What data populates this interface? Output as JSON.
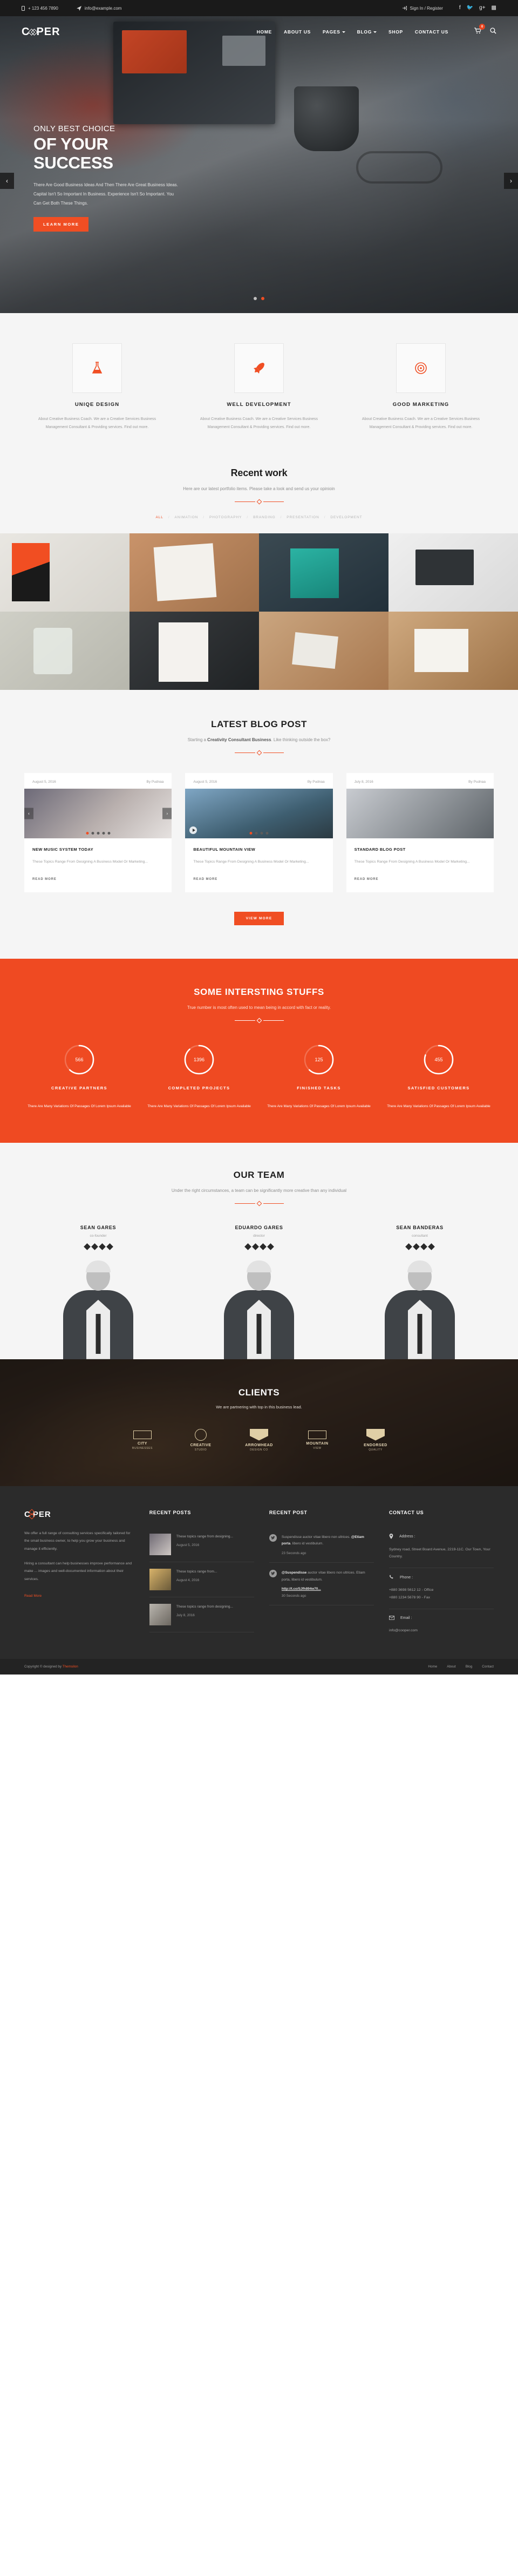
{
  "topbar": {
    "phone": "+ 123 456 7890",
    "email": "info@example.com",
    "signin": "Sign In / Register",
    "socials": [
      "facebook-icon",
      "twitter-icon",
      "google-plus-icon",
      "flickr-icon"
    ]
  },
  "nav": {
    "logo": "COOPER",
    "logo_left": "C",
    "logo_right": "PER",
    "items": [
      {
        "label": "HOME",
        "caret": false
      },
      {
        "label": "ABOUT US",
        "caret": false
      },
      {
        "label": "PAGES",
        "caret": true
      },
      {
        "label": "BLOG",
        "caret": true
      },
      {
        "label": "SHOP",
        "caret": false
      },
      {
        "label": "CONTACT US",
        "caret": false
      }
    ],
    "cart_count": "0"
  },
  "hero": {
    "sup": "ONLY BEST CHOICE",
    "line1": "OF YOUR",
    "line2": "SUCCESS",
    "paragraph": "There Are Good Business Ideas And Then There Are Great Business Ideas. Capital Isn't So Important In Business. Experience Isn't So Important. You Can Get Both These Things.",
    "cta": "LEARN MORE",
    "prev": "‹",
    "next": "›"
  },
  "services": [
    {
      "icon": "flask-icon",
      "title": "UNIQE DESIGN",
      "text": "About Creative Business Coach. We are a Creative Services Business Management Consultant & Providing services. Find out more."
    },
    {
      "icon": "rocket-icon",
      "title": "WELL DEVELOPMENT",
      "text": "About Creative Business Coach. We are a Creative Services Business Management Consultant & Providing services. Find out more."
    },
    {
      "icon": "target-icon",
      "title": "GOOD MARKETING",
      "text": "About Creative Business Coach. We are a Creative Services Business Management Consultant & Providing services. Find out more."
    }
  ],
  "recent_work": {
    "title": "Recent work",
    "subtitle": "Here are our latest portfolio items. Please take a look and send us your opinioin",
    "filters": [
      "ALL",
      "ANIMATION",
      "PHOTOGRAPHY",
      "BRANDING",
      "PRESENTATION",
      "DEVELOPMENT"
    ],
    "active_filter": "ALL",
    "separator": "/",
    "tiles": [
      "poster-red-black",
      "sketchbook-mockup",
      "teal-device-display",
      "desk-imac-workspace",
      "original-jar-label",
      "free-partnership-book",
      "business-cards-desk",
      "original-package-box"
    ]
  },
  "blog": {
    "title": "LATEST BLOG POST",
    "subtitle_pre": "Starting a ",
    "subtitle_bold": "Creativity Consultant Business",
    "subtitle_post": ". Like thinking outside the box?",
    "posts": [
      {
        "date": "August 5, 2016",
        "author": "By Pudnaa",
        "title": "NEW MUSIC SYSTEM TODAY",
        "excerpt": "These Topics Range From Designing A Business Model Or Marketing...",
        "readmore": "READ MORE"
      },
      {
        "date": "August 5, 2016",
        "author": "By Pudnaa",
        "title": "BEAUTIFUL MOUNTAIN VIEW",
        "excerpt": "These Topics Range From Designing A Business Model Or Marketing...",
        "readmore": "READ MORE"
      },
      {
        "date": "July 8, 2016",
        "author": "By Pudnaa",
        "title": "STANDARD BLOG POST",
        "excerpt": "These Topics Range From Designing A Business Model Or Marketing...",
        "readmore": "READ MORE"
      }
    ],
    "view_more": "VIEW MORE"
  },
  "counters": {
    "title": "SOME INTERSTING STUFFS",
    "subtitle": "True number is most often used to mean being in accord with fact or reality.",
    "items": [
      {
        "value": "566",
        "label": "CREATIVE PARTNERS",
        "text": "There Are Many Variations Of Passages Of Lorem Ipsum Available",
        "percent": 62
      },
      {
        "value": "1396",
        "label": "COMPLETED PROJECTS",
        "text": "There Are Many Variations Of Passages Of Lorem Ipsum Available",
        "percent": 88
      },
      {
        "value": "125",
        "label": "FINISHED TASKS",
        "text": "There Are Many Variations Of Passages Of Lorem Ipsum Available",
        "percent": 62
      },
      {
        "value": "455",
        "label": "SATISFIED CUSTOMERS",
        "text": "There Are Many Variations Of Passages Of Lorem Ipsum Available",
        "percent": 80
      }
    ]
  },
  "team": {
    "title": "OUR TEAM",
    "subtitle": "Under the right circumstances, a team can be significantly more creative than any individual",
    "members": [
      {
        "name": "SEAN GARES",
        "role": "co-founder"
      },
      {
        "name": "EDUARDO GARES",
        "role": "director"
      },
      {
        "name": "SEAN BANDERAS",
        "role": "consultant"
      }
    ]
  },
  "clients": {
    "title": "CLIENTS",
    "subtitle": "We are partnering with top in this business lead.",
    "logos": [
      {
        "top": "CITY",
        "bottom": "BUSINESSES",
        "shape": "bar"
      },
      {
        "top": "CREATIVE",
        "bottom": "STUDIO",
        "shape": "round"
      },
      {
        "top": "ARROWHEAD",
        "bottom": "DESIGN CO",
        "shape": "badge"
      },
      {
        "top": "MOUNTAIN",
        "bottom": "VIEW",
        "shape": "bar"
      },
      {
        "top": "ENDORSED",
        "bottom": "QUALITY",
        "shape": "badge"
      }
    ]
  },
  "footer": {
    "logo_left": "C",
    "logo_right": "PER",
    "about_p1": "We offer a full range of consulting services specifically tailored for the smail business owner, to help you grow your business and manage it efficiently.",
    "about_p2": "Hiring a consultant can help businesses improve performance and make ... images and well-documented information about their services.",
    "readmore": "Read More",
    "recent_posts_title": "RECENT POSTS",
    "recent_posts": [
      {
        "text": "These topics range from designing...",
        "date": "August 5, 2016"
      },
      {
        "text": "These topics range from...",
        "date": "August 4, 2016"
      },
      {
        "text": "These topics range from designing...",
        "date": "July 8, 2016"
      }
    ],
    "recent_post_title": "RECENT POST",
    "tweets": [
      {
        "pre": "Suspendisse auctor vitae libero non ultrices. ",
        "handle": "@Etiam porta",
        "post": ". libero id vestibulum.",
        "link": "",
        "ago": "23 Seconds ago"
      },
      {
        "pre": "",
        "handle": "@Suspendisse",
        "post": " auctor vitae libero non ultrices. Etiam porta, libero id vestibulum.",
        "link": "http://t.co/SJfh894w70...",
        "ago": "30 Seconds ago"
      }
    ],
    "contact_title": "CONTACT US",
    "contact": [
      {
        "icon": "location-pin-icon",
        "label": "Address :",
        "value": "Sydney road, Street Board Avenue, 2219-11C. Our Town, Your Country."
      },
      {
        "icon": "phone-icon",
        "label": "Phone :",
        "value": "+880 3698 5612 12 - Office\n+880 1234 5678 90 - Fax"
      },
      {
        "icon": "envelope-icon",
        "label": "Email :",
        "value": "info@cooper.com"
      }
    ]
  },
  "copybar": {
    "text_pre": "Copyright © designed by ",
    "brand": "Themsilon",
    "links": [
      "Home",
      "About",
      "Blog",
      "Contact"
    ]
  },
  "colors": {
    "accent": "#f04e23",
    "dark": "#2b2b2b",
    "topbar": "#1a1a1a"
  }
}
